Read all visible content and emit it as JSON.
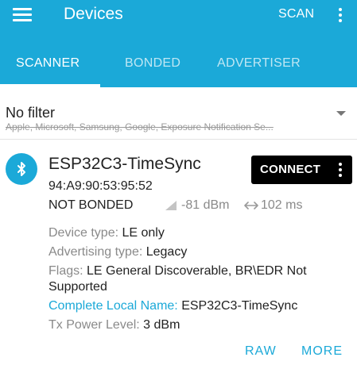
{
  "appbar": {
    "title": "Devices",
    "scan_label": "SCAN",
    "menu_icon": "menu-icon",
    "overflow_icon": "more-vert-icon",
    "color": "#1ba9d8"
  },
  "tabs": [
    {
      "label": "SCANNER",
      "active": true
    },
    {
      "label": "BONDED",
      "active": false
    },
    {
      "label": "ADVERTISER",
      "active": false
    }
  ],
  "filter": {
    "title": "No filter",
    "excluded": "Apple, Microsoft, Samsung, Google, Exposure Notification Se..."
  },
  "device": {
    "icon": "bluetooth-icon",
    "name": "ESP32C3-TimeSync",
    "mac": "94:A9:90:53:95:52",
    "bond_state": "NOT BONDED",
    "rssi": "-81 dBm",
    "interval": "102 ms",
    "connect_label": "CONNECT",
    "details": [
      {
        "label": "Device type: ",
        "value": "LE only"
      },
      {
        "label": "Advertising type: ",
        "value": "Legacy"
      },
      {
        "label": "Flags: ",
        "value": "LE General Discoverable, BR\\EDR Not Supported"
      },
      {
        "label": "Complete Local Name: ",
        "value": "ESP32C3-TimeSync"
      },
      {
        "label": "Tx Power Level: ",
        "value": "3 dBm"
      }
    ],
    "actions": {
      "raw": "RAW",
      "more": "MORE"
    }
  }
}
